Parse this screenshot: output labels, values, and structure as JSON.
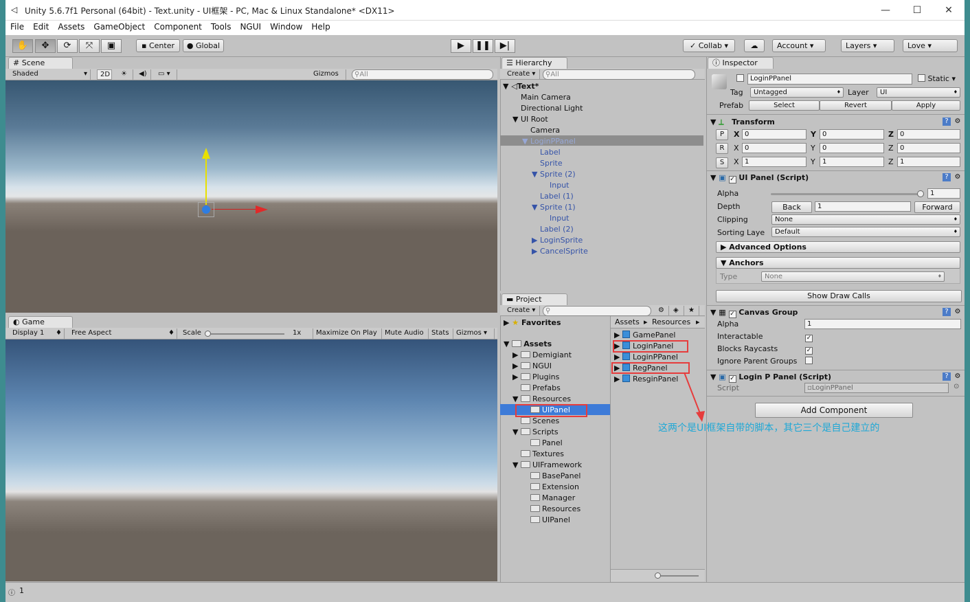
{
  "window": {
    "title": "Unity 5.6.7f1 Personal (64bit) - Text.unity - UI框架 - PC, Mac & Linux Standalone* <DX11>",
    "controls": {
      "minimize": "—",
      "maximize": "☐",
      "close": "✕"
    }
  },
  "menu": [
    "File",
    "Edit",
    "Assets",
    "GameObject",
    "Component",
    "Tools",
    "NGUI",
    "Window",
    "Help"
  ],
  "toolbar": {
    "pivot": "Center",
    "space": "Global",
    "collab": "Collab",
    "account": "Account",
    "layers": "Layers",
    "layout": "Love"
  },
  "scene": {
    "tab": "Scene",
    "shading": "Shaded",
    "mode2d": "2D",
    "gizmos": "Gizmos",
    "search_placeholder": "All"
  },
  "game": {
    "tab": "Game",
    "display": "Display 1",
    "aspect": "Free Aspect",
    "scale_label": "Scale",
    "scale_value": "1x",
    "maximize": "Maximize On Play",
    "mute": "Mute Audio",
    "stats": "Stats",
    "gizmos": "Gizmos"
  },
  "hierarchy": {
    "tab": "Hierarchy",
    "create": "Create",
    "search_placeholder": "All",
    "scene_name": "Text*",
    "items": [
      {
        "label": "Main Camera"
      },
      {
        "label": "Directional Light"
      },
      {
        "label": "UI Root"
      },
      {
        "label": "Camera"
      },
      {
        "label": "LoginPPanel"
      },
      {
        "label": "Label"
      },
      {
        "label": "Sprite"
      },
      {
        "label": "Sprite (2)"
      },
      {
        "label": "Input"
      },
      {
        "label": "Label (1)"
      },
      {
        "label": "Sprite (1)"
      },
      {
        "label": "Input"
      },
      {
        "label": "Label (2)"
      },
      {
        "label": "LoginSprite"
      },
      {
        "label": "CancelSprite"
      }
    ]
  },
  "project": {
    "tab": "Project",
    "create": "Create",
    "favorites": "Favorites",
    "assets": "Assets",
    "tree": [
      {
        "label": "Demigiant"
      },
      {
        "label": "NGUI"
      },
      {
        "label": "Plugins"
      },
      {
        "label": "Prefabs"
      },
      {
        "label": "Resources"
      },
      {
        "label": "UIPanel"
      },
      {
        "label": "Scenes"
      },
      {
        "label": "Scripts"
      },
      {
        "label": "Panel"
      },
      {
        "label": "Textures"
      },
      {
        "label": "UIFramework"
      },
      {
        "label": "BasePanel"
      },
      {
        "label": "Extension"
      },
      {
        "label": "Manager"
      },
      {
        "label": "Resources"
      },
      {
        "label": "UIPanel"
      }
    ],
    "breadcrumb": [
      "Assets",
      "Resources"
    ],
    "files": [
      "GamePanel",
      "LoginPanel",
      "LoginPPanel",
      "RegPanel",
      "ResginPanel"
    ]
  },
  "annotation": "这两个是UI框架自带的脚本，其它三个是自己建立的",
  "inspector": {
    "tab": "Inspector",
    "object_name": "LoginPPanel",
    "static_label": "Static",
    "tag_label": "Tag",
    "tag_value": "Untagged",
    "layer_label": "Layer",
    "layer_value": "UI",
    "prefab_label": "Prefab",
    "prefab_select": "Select",
    "prefab_revert": "Revert",
    "prefab_apply": "Apply",
    "transform": {
      "title": "Transform",
      "rows": [
        {
          "btn": "P",
          "x": "0",
          "y": "0",
          "z": "0"
        },
        {
          "btn": "R",
          "x": "0",
          "y": "0",
          "z": "0"
        },
        {
          "btn": "S",
          "x": "1",
          "y": "1",
          "z": "1"
        }
      ],
      "axis_x": "X",
      "axis_y": "Y",
      "axis_z": "Z"
    },
    "uipanel": {
      "title": "UI Panel (Script)",
      "alpha_label": "Alpha",
      "alpha_value": "1",
      "alpha_fraction": 1.0,
      "depth_label": "Depth",
      "back": "Back",
      "depth_value": "1",
      "forward": "Forward",
      "clipping_label": "Clipping",
      "clipping_value": "None",
      "sorting_label": "Sorting Laye",
      "sorting_value": "Default",
      "advanced": "Advanced Options",
      "anchors": "Anchors",
      "type_label": "Type",
      "type_value": "None",
      "show_draw_calls": "Show Draw Calls"
    },
    "canvas_group": {
      "title": "Canvas Group",
      "alpha_label": "Alpha",
      "alpha_value": "1",
      "interactable": "Interactable",
      "blocks": "Blocks Raycasts",
      "ignore": "Ignore Parent Groups"
    },
    "login_script": {
      "title": "Login P Panel (Script)",
      "script_label": "Script",
      "script_value": "LoginPPanel"
    },
    "add_component": "Add Component"
  },
  "status": {
    "count": "1"
  },
  "colors": {
    "selection": "#3d7bd8",
    "highlight_red": "#e63c3c",
    "annotation_cyan": "#1fa8d6"
  }
}
